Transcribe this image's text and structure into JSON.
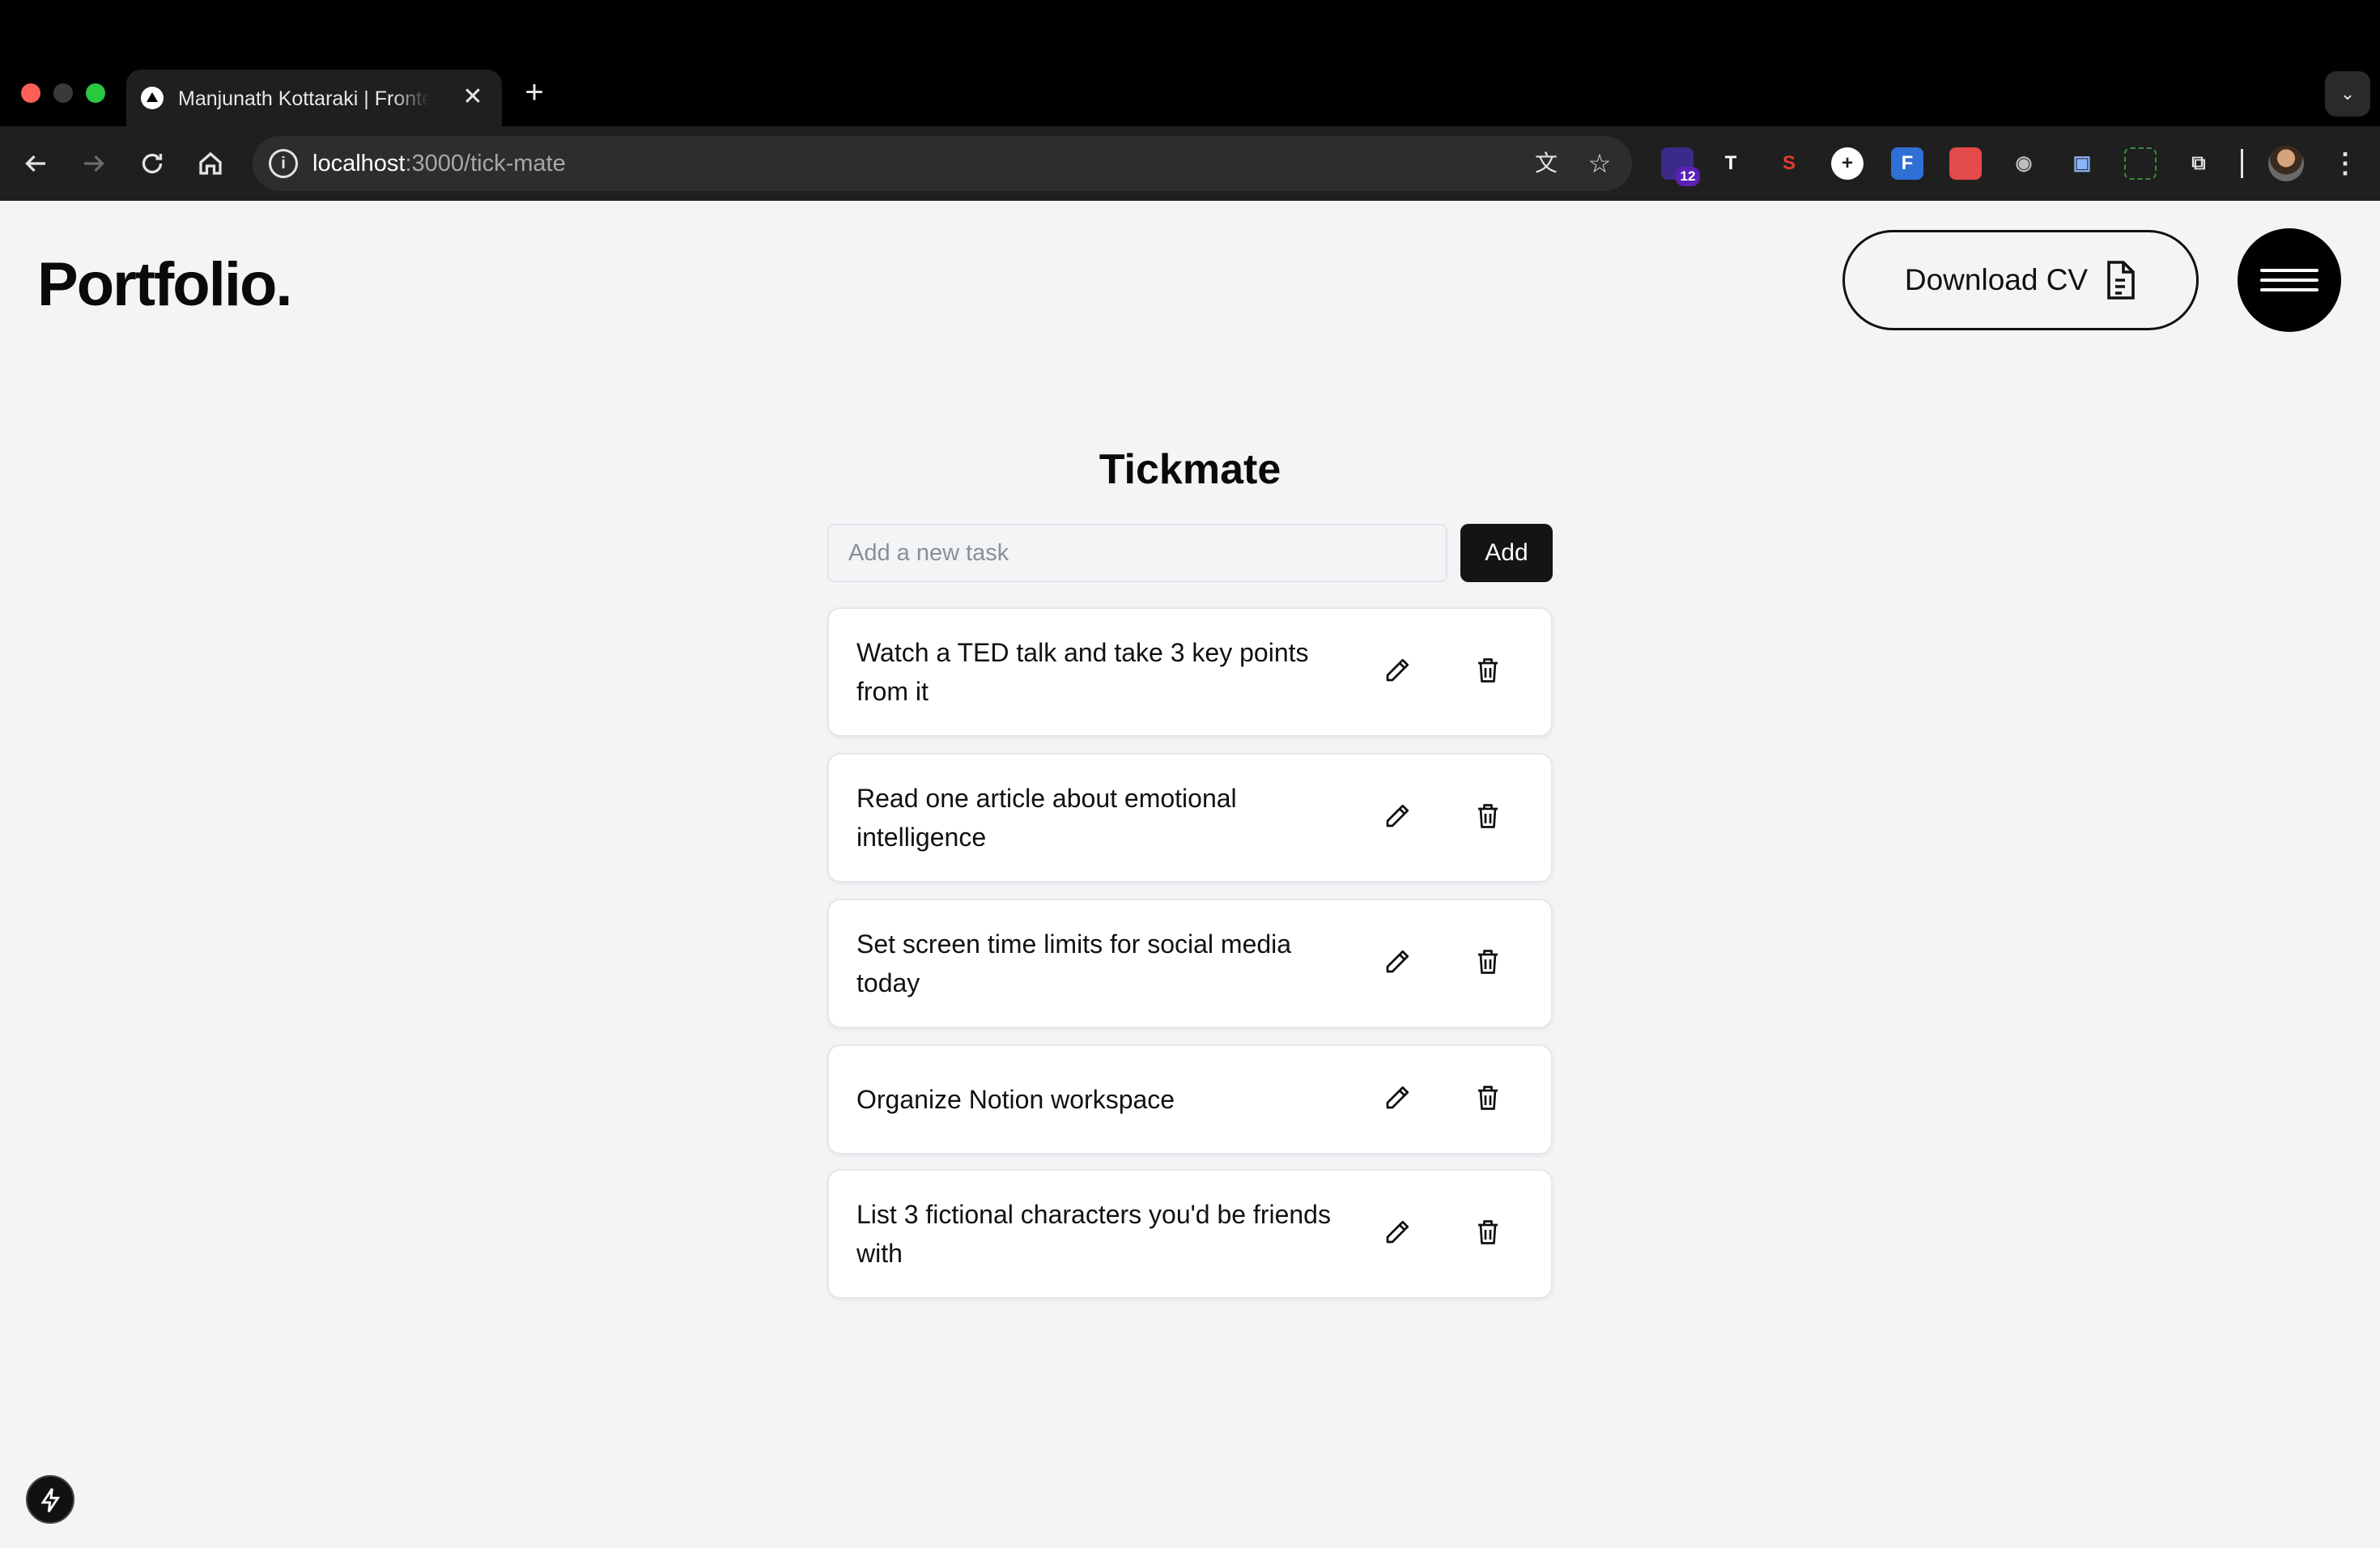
{
  "browser": {
    "tab_title": "Manjunath Kottaraki | Frontend Developer",
    "url_host": "localhost",
    "url_path": ":3000/tick-mate",
    "extension_badge": "12"
  },
  "header": {
    "logo": "Portfolio.",
    "download_cv_label": "Download CV"
  },
  "app": {
    "title": "Tickmate",
    "input_placeholder": "Add a new task",
    "input_value": "",
    "add_label": "Add"
  },
  "tasks": [
    "Watch a TED talk and take 3 key points from it",
    "Read one article about emotional intelligence",
    "Set screen time limits for social media today",
    "Organize Notion workspace",
    "List 3 fictional characters you'd be friends with"
  ]
}
